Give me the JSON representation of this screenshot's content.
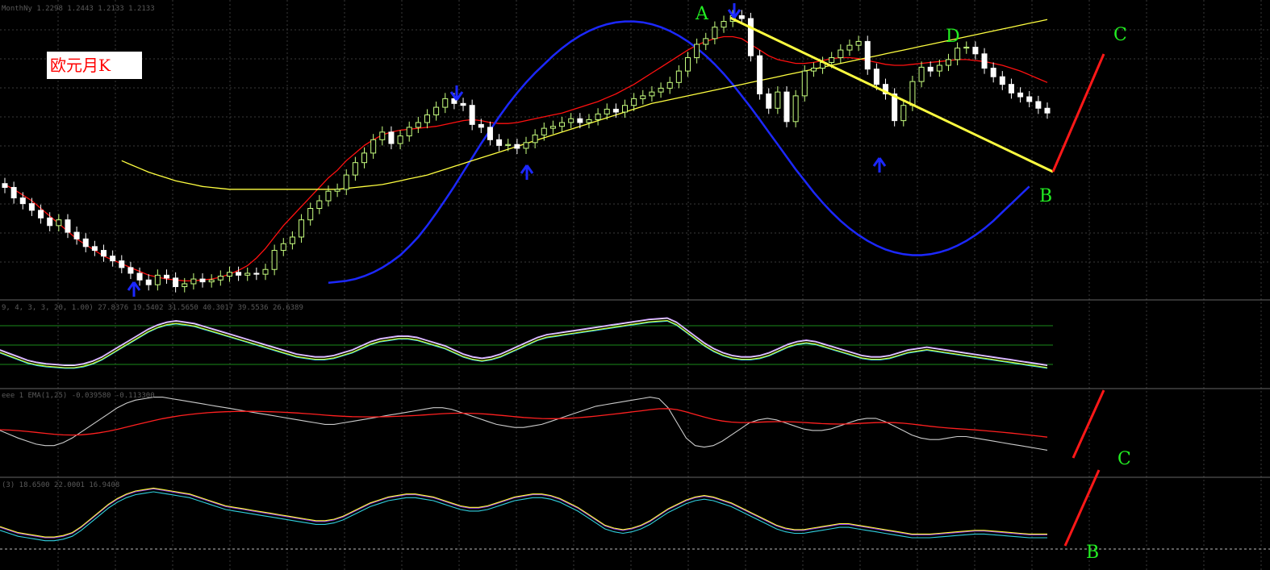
{
  "chart_label": "欧元月K",
  "panels": {
    "price_header": "MonthNy 1.2298 1.2443 1.2133 1.2133",
    "stoch_header": "9, 4, 3, 3, 20, 1.00) 27.8376 19.5402 31.5650 40.3017 39.5536 26.6389",
    "macd_header": "eee 1 EMA(1,25) -0.039580 -0.113300",
    "rsi_header": "(3) 18.6500 22.0001 16.9408"
  },
  "labels": {
    "A": "A",
    "B": "B",
    "C": "C",
    "D": "D"
  },
  "colors": {
    "bull": "#c8ff80",
    "bear": "#ffffff",
    "ma_red": "#ff1010",
    "ma_blue": "#1c28ff",
    "ma_yellow": "#ffff40",
    "trend": "#ffff40",
    "projection": "#ff1818",
    "label": "#22ee22",
    "arrow": "#1c28ff",
    "grid": "#3a3a3a"
  },
  "chart_data": [
    {
      "type": "candlestick",
      "title": "欧元月K",
      "header": "MonthNy 1.2298 1.2443 1.2133 1.2133",
      "close_series": [
        1.302,
        1.291,
        1.285,
        1.278,
        1.27,
        1.262,
        1.268,
        1.255,
        1.248,
        1.24,
        1.236,
        1.23,
        1.225,
        1.218,
        1.212,
        1.205,
        1.2,
        1.21,
        1.207,
        1.198,
        1.201,
        1.206,
        1.203,
        1.205,
        1.209,
        1.213,
        1.21,
        1.212,
        1.211,
        1.216,
        1.236,
        1.243,
        1.25,
        1.268,
        1.28,
        1.288,
        1.298,
        1.3,
        1.315,
        1.328,
        1.338,
        1.352,
        1.36,
        1.348,
        1.356,
        1.365,
        1.37,
        1.378,
        1.386,
        1.395,
        1.39,
        1.388,
        1.368,
        1.365,
        1.352,
        1.346,
        1.347,
        1.343,
        1.349,
        1.357,
        1.364,
        1.366,
        1.37,
        1.374,
        1.37,
        1.373,
        1.379,
        1.384,
        1.381,
        1.388,
        1.395,
        1.398,
        1.402,
        1.406,
        1.412,
        1.424,
        1.438,
        1.452,
        1.458,
        1.47,
        1.476,
        1.482,
        1.479,
        1.44,
        1.4,
        1.385,
        1.402,
        1.371,
        1.398,
        1.424,
        1.427,
        1.433,
        1.438,
        1.446,
        1.451,
        1.455,
        1.426,
        1.41,
        1.4,
        1.372,
        1.388,
        1.413,
        1.428,
        1.424,
        1.43,
        1.436,
        1.448,
        1.449,
        1.442,
        1.427,
        1.418,
        1.41,
        1.401,
        1.397,
        1.392,
        1.385,
        1.38
      ],
      "moving_averages": [
        {
          "color": "#ff1010",
          "values": [
            1.305,
            1.3,
            1.294,
            1.288,
            1.28,
            1.272,
            1.264,
            1.256,
            1.248,
            1.242,
            1.236,
            1.23,
            1.226,
            1.222,
            1.218,
            1.214,
            1.21,
            1.208,
            1.206,
            1.205,
            1.204,
            1.204,
            1.205,
            1.206,
            1.208,
            1.211,
            1.215,
            1.22,
            1.228,
            1.238,
            1.25,
            1.262,
            1.272,
            1.282,
            1.292,
            1.302,
            1.312,
            1.32,
            1.33,
            1.338,
            1.346,
            1.352,
            1.357,
            1.36,
            1.362,
            1.363,
            1.364,
            1.365,
            1.366,
            1.368,
            1.37,
            1.372,
            1.373,
            1.372,
            1.37,
            1.369,
            1.369,
            1.37,
            1.372,
            1.374,
            1.376,
            1.378,
            1.38,
            1.383,
            1.386,
            1.389,
            1.392,
            1.396,
            1.4,
            1.405,
            1.41,
            1.416,
            1.422,
            1.428,
            1.434,
            1.44,
            1.446,
            1.451,
            1.455,
            1.458,
            1.46,
            1.46,
            1.458,
            1.452,
            1.446,
            1.44,
            1.436,
            1.434,
            1.432,
            1.432,
            1.433,
            1.435,
            1.437,
            1.438,
            1.438,
            1.437,
            1.435,
            1.433,
            1.431,
            1.43,
            1.43,
            1.431,
            1.432,
            1.433,
            1.434,
            1.435,
            1.436,
            1.436,
            1.435,
            1.434,
            1.432,
            1.43,
            1.427,
            1.424,
            1.42,
            1.416,
            1.412
          ]
        },
        {
          "color": "#1c28ff",
          "values": [
            null,
            null,
            null,
            null,
            null,
            null,
            null,
            null,
            null,
            null,
            null,
            null,
            null,
            null,
            null,
            null,
            null,
            null,
            null,
            null,
            null,
            null,
            null,
            null,
            null,
            null,
            null,
            null,
            null,
            null,
            null,
            null,
            null,
            null,
            null,
            null,
            1.202,
            1.203,
            1.204,
            1.206,
            1.209,
            1.213,
            1.218,
            1.224,
            1.231,
            1.24,
            1.25,
            1.262,
            1.275,
            1.289,
            1.303,
            1.318,
            1.333,
            1.348,
            1.362,
            1.376,
            1.389,
            1.401,
            1.412,
            1.422,
            1.431,
            1.44,
            1.448,
            1.455,
            1.461,
            1.466,
            1.47,
            1.473,
            1.475,
            1.476,
            1.476,
            1.475,
            1.473,
            1.47,
            1.466,
            1.461,
            1.455,
            1.448,
            1.44,
            1.431,
            1.421,
            1.41,
            1.398,
            1.386,
            1.373,
            1.36,
            1.347,
            1.334,
            1.321,
            1.309,
            1.297,
            1.286,
            1.276,
            1.267,
            1.259,
            1.252,
            1.246,
            1.241,
            1.237,
            1.234,
            1.232,
            1.231,
            1.231,
            1.232,
            1.234,
            1.237,
            1.241,
            1.246,
            1.252,
            1.259,
            1.267,
            1.276,
            1.285,
            1.294,
            1.303
          ]
        },
        {
          "color": "#ffff40",
          "values": [
            null,
            null,
            null,
            null,
            null,
            null,
            null,
            null,
            null,
            null,
            null,
            null,
            null,
            1.33,
            1.326,
            1.322,
            1.318,
            1.315,
            1.312,
            1.309,
            1.307,
            1.305,
            1.303,
            1.302,
            1.301,
            1.3,
            1.3,
            1.3,
            1.3,
            1.3,
            1.3,
            1.3,
            1.3,
            1.3,
            1.3,
            1.3,
            1.3,
            1.3,
            1.301,
            1.302,
            1.303,
            1.304,
            1.305,
            1.307,
            1.309,
            1.311,
            1.313,
            1.315,
            1.318,
            1.321,
            1.324,
            1.327,
            1.33,
            1.333,
            1.336,
            1.339,
            1.342,
            1.345,
            1.348,
            1.351,
            1.354,
            1.357,
            1.36,
            1.363,
            1.366,
            1.369,
            1.372,
            1.375,
            1.378,
            1.381,
            1.384,
            1.387,
            1.39,
            1.392,
            1.394,
            1.396,
            1.398,
            1.4,
            1.402,
            1.404,
            1.406,
            1.408,
            1.41,
            1.412,
            1.414,
            1.416,
            1.418,
            1.42,
            1.422,
            1.424,
            1.426,
            1.428,
            1.43,
            1.432,
            1.434,
            1.436,
            1.438,
            1.44,
            1.442,
            1.444,
            1.446,
            1.448,
            1.45,
            1.452,
            1.454,
            1.456,
            1.458,
            1.46,
            1.462,
            1.464,
            1.466,
            1.468,
            1.47,
            1.472,
            1.474,
            1.476,
            1.478
          ]
        }
      ],
      "annotations": [
        "A",
        "B",
        "C",
        "D"
      ]
    },
    {
      "type": "line",
      "header": "9, 4, 3, 3, 20, 1.00) 27.8376 19.5402 31.5650 40.3017 39.5536 26.6389",
      "series": [
        {
          "values": [
            40,
            35,
            30,
            25,
            22,
            20,
            19,
            18,
            18,
            20,
            24,
            30,
            38,
            46,
            54,
            62,
            70,
            76,
            80,
            82,
            80,
            78,
            74,
            70,
            66,
            62,
            58,
            54,
            50,
            46,
            42,
            38,
            34,
            32,
            30,
            30,
            32,
            36,
            40,
            46,
            52,
            56,
            58,
            60,
            60,
            58,
            54,
            50,
            46,
            40,
            34,
            30,
            28,
            30,
            34,
            40,
            46,
            52,
            58,
            62,
            64,
            66,
            68,
            70,
            72,
            74,
            76,
            78,
            80,
            82,
            84,
            85,
            86,
            80,
            70,
            60,
            50,
            42,
            36,
            32,
            30,
            30,
            32,
            36,
            42,
            48,
            52,
            54,
            52,
            48,
            44,
            40,
            36,
            32,
            30,
            30,
            32,
            36,
            40,
            42,
            44,
            42,
            40,
            38,
            36,
            34,
            32,
            30,
            28,
            26,
            24,
            22,
            20,
            18
          ]
        }
      ]
    },
    {
      "type": "line",
      "header": "eee 1 EMA(1,25) -0.039580 -0.113300",
      "series": [
        {
          "values": [
            50,
            45,
            40,
            36,
            32,
            30,
            30,
            34,
            40,
            48,
            56,
            64,
            72,
            80,
            86,
            90,
            92,
            94,
            94,
            92,
            90,
            88,
            86,
            84,
            82,
            80,
            78,
            76,
            74,
            72,
            70,
            68,
            66,
            64,
            62,
            60,
            58,
            58,
            60,
            62,
            64,
            66,
            68,
            70,
            72,
            74,
            76,
            78,
            80,
            80,
            78,
            74,
            70,
            66,
            62,
            58,
            56,
            54,
            54,
            56,
            58,
            62,
            66,
            70,
            74,
            78,
            82,
            84,
            86,
            88,
            90,
            92,
            94,
            92,
            80,
            60,
            40,
            30,
            28,
            30,
            36,
            44,
            52,
            60,
            64,
            66,
            64,
            60,
            56,
            52,
            50,
            50,
            52,
            56,
            60,
            64,
            66,
            66,
            62,
            56,
            50,
            44,
            40,
            38,
            38,
            40,
            42,
            42,
            40,
            38,
            36,
            34,
            32,
            30,
            28,
            26,
            24
          ]
        }
      ]
    },
    {
      "type": "line",
      "header": "(3) 18.6500 22.0001 16.9408",
      "series": [
        {
          "values": [
            40,
            36,
            32,
            30,
            28,
            26,
            26,
            28,
            32,
            40,
            50,
            60,
            70,
            78,
            84,
            88,
            90,
            92,
            90,
            88,
            86,
            84,
            80,
            76,
            72,
            68,
            66,
            64,
            62,
            60,
            58,
            56,
            54,
            52,
            50,
            48,
            48,
            50,
            54,
            60,
            66,
            72,
            76,
            80,
            82,
            84,
            84,
            82,
            80,
            76,
            72,
            68,
            66,
            66,
            68,
            72,
            76,
            80,
            82,
            84,
            84,
            82,
            78,
            72,
            66,
            58,
            50,
            42,
            38,
            36,
            38,
            42,
            48,
            56,
            64,
            70,
            76,
            80,
            82,
            80,
            76,
            72,
            66,
            60,
            54,
            48,
            42,
            38,
            36,
            36,
            38,
            40,
            42,
            44,
            44,
            42,
            40,
            38,
            36,
            34,
            32,
            30,
            30,
            30,
            31,
            32,
            33,
            34,
            35,
            35,
            34,
            33,
            32,
            31,
            30,
            30,
            30
          ]
        }
      ]
    }
  ]
}
